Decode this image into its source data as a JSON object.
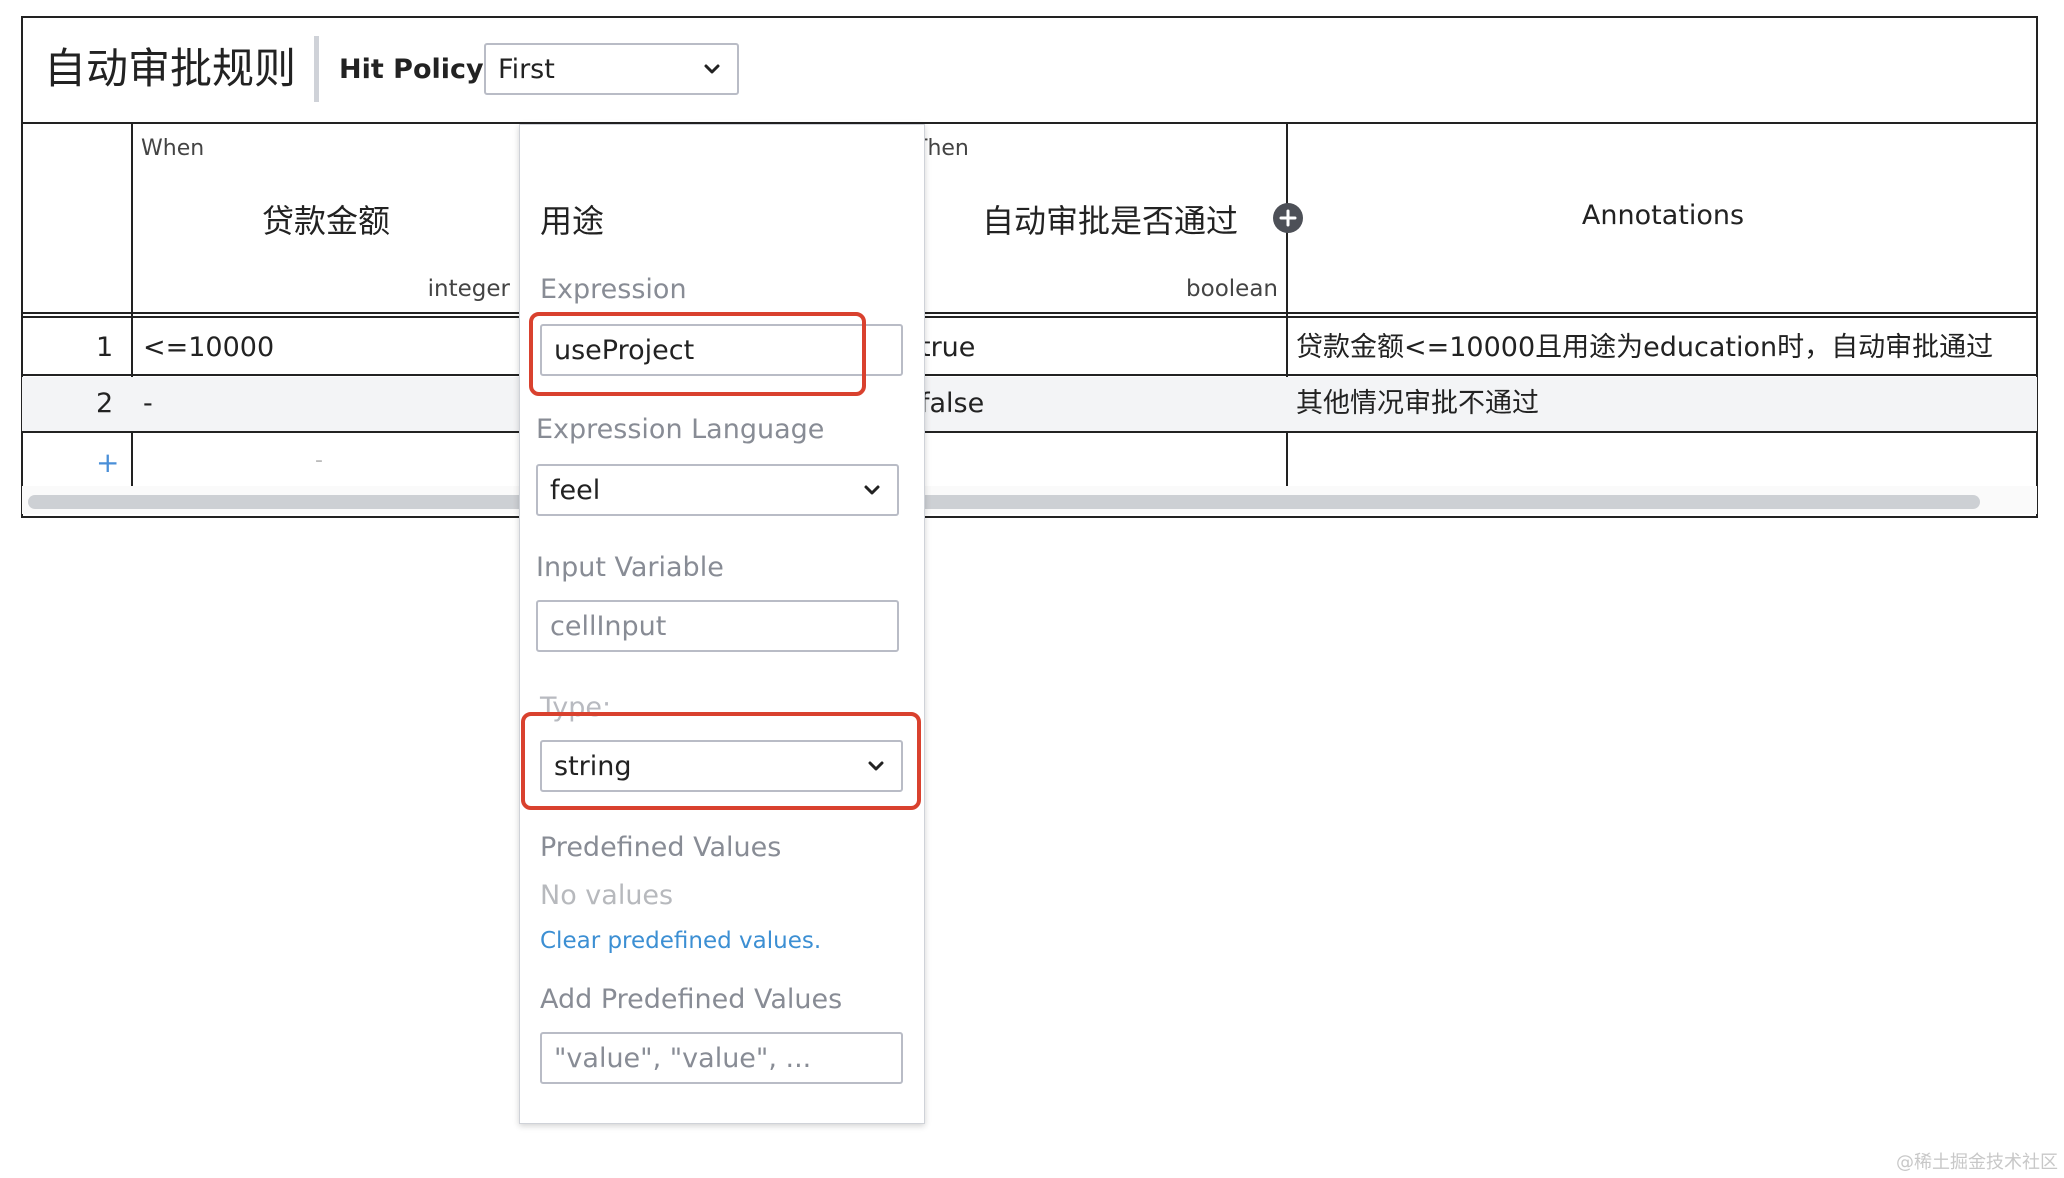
{
  "table": {
    "title": "自动审批规则",
    "hit_policy_label": "Hit Policy:",
    "hit_policy_value": "First",
    "when_label": "When",
    "then_label": "Then",
    "input_column": {
      "name": "贷款金额",
      "type": "integer"
    },
    "output_column": {
      "name": "自动审批是否通过",
      "type": "boolean"
    },
    "annotations_header": "Annotations",
    "rows": [
      {
        "index": "1",
        "input": "<=10000",
        "output": "true",
        "annotation": "贷款金额<=10000且用途为education时，自动审批通过"
      },
      {
        "index": "2",
        "input": "-",
        "output": "false",
        "annotation": "其他情况审批不通过"
      }
    ],
    "add_row_symbol": "+",
    "new_row_placeholder": "-"
  },
  "panel": {
    "title": "用途",
    "expression_label": "Expression",
    "expression_value": "useProject",
    "expression_language_label": "Expression Language",
    "expression_language_value": "feel",
    "input_variable_label": "Input Variable",
    "input_variable_placeholder": "cellInput",
    "type_label": "Type:",
    "type_value": "string",
    "predefined_values_label": "Predefined Values",
    "no_values_text": "No values",
    "clear_link": "Clear predefined values.",
    "add_predefined_label": "Add Predefined Values",
    "add_predefined_placeholder": "\"value\", \"value\", ..."
  },
  "watermark": "@稀土掘金技术社区",
  "colors": {
    "highlight": "#d9412e",
    "link": "#3c8fd3",
    "add_row": "#4a8fd8"
  },
  "icons": [
    "chevron-down-icon",
    "add-column-icon"
  ]
}
